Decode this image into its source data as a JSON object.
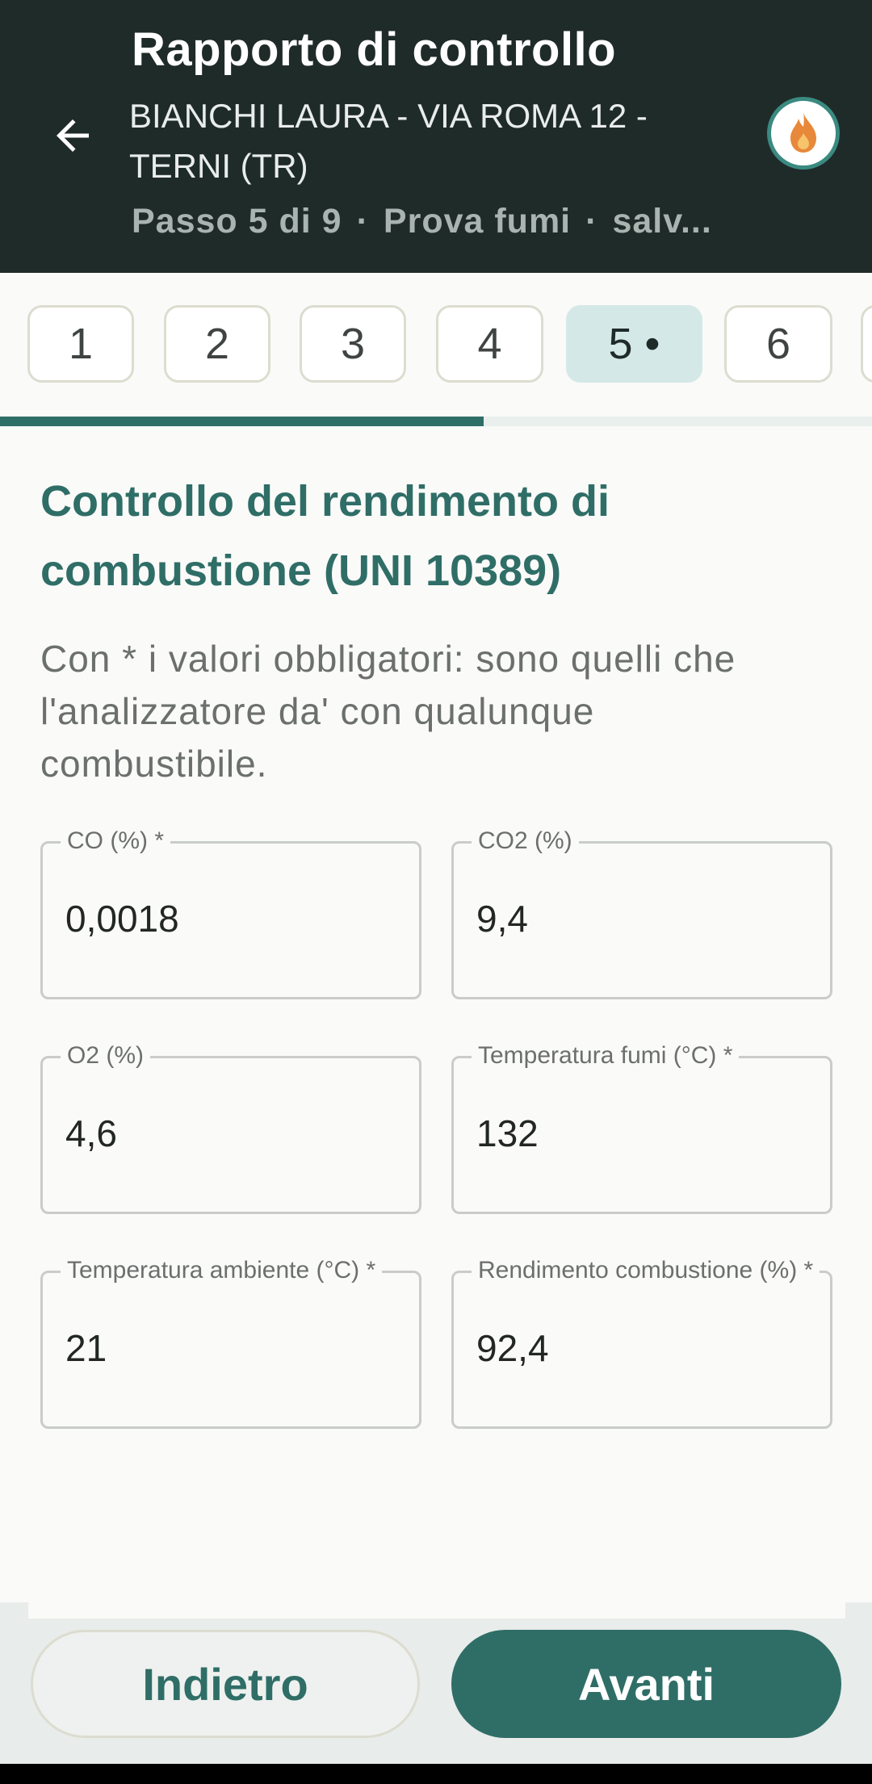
{
  "header": {
    "title": "Rapporto di controllo",
    "subtitle": "BIANCHI LAURA - VIA ROMA 12 - TERNI (TR)",
    "step_text": "Passo 5 di 9",
    "step_name": "Prova fumi",
    "save_status": "salv...",
    "separator": "·",
    "back_icon": "arrow-left-icon",
    "badge_icon": "flame-icon",
    "accent_color": "#2f6e67",
    "flame_color": "#e8883a"
  },
  "steps": {
    "items": [
      {
        "label": "1"
      },
      {
        "label": "2"
      },
      {
        "label": "3"
      },
      {
        "label": "4"
      },
      {
        "label": "5 •"
      },
      {
        "label": "6"
      }
    ],
    "current": 5,
    "total": 9,
    "progress": 0.555
  },
  "section": {
    "title": "Controllo del rendimento di combustione (UNI 10389)",
    "description": "Con * i valori obbligatori: sono quelli che l'analizzatore da' con qualunque combustibile."
  },
  "fields": [
    {
      "label": "CO (%) *",
      "value": "0,0018"
    },
    {
      "label": "CO2 (%)",
      "value": "9,4"
    },
    {
      "label": "O2 (%)",
      "value": "4,6"
    },
    {
      "label": "Temperatura fumi (°C) *",
      "value": "132"
    },
    {
      "label": "Temperatura ambiente (°C) *",
      "value": "21"
    },
    {
      "label": "Rendimento combustione (%) *",
      "value": "92,4"
    }
  ],
  "footer": {
    "back_label": "Indietro",
    "next_label": "Avanti"
  }
}
